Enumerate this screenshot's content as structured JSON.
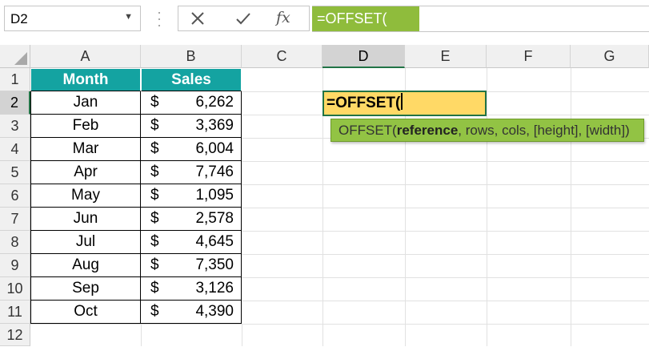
{
  "name_box": {
    "value": "D2"
  },
  "formula_bar": {
    "fx_label": "fx",
    "value": "=OFFSET("
  },
  "columns": [
    "A",
    "B",
    "C",
    "D",
    "E",
    "F",
    "G"
  ],
  "rows": [
    "1",
    "2",
    "3",
    "4",
    "5",
    "6",
    "7",
    "8",
    "9",
    "10",
    "11",
    "12"
  ],
  "table": {
    "headers": [
      "Month",
      "Sales"
    ],
    "currency": "$",
    "rows": [
      {
        "month": "Jan",
        "sales": "6,262"
      },
      {
        "month": "Feb",
        "sales": "3,369"
      },
      {
        "month": "Mar",
        "sales": "6,004"
      },
      {
        "month": "Apr",
        "sales": "7,746"
      },
      {
        "month": "May",
        "sales": "1,095"
      },
      {
        "month": "Jun",
        "sales": "2,578"
      },
      {
        "month": "Jul",
        "sales": "4,645"
      },
      {
        "month": "Aug",
        "sales": "7,350"
      },
      {
        "month": "Sep",
        "sales": "3,126"
      },
      {
        "month": "Oct",
        "sales": "4,390"
      }
    ]
  },
  "active_cell": {
    "value": "=OFFSET("
  },
  "tooltip": {
    "func": "OFFSET(",
    "arg_current": "reference",
    "rest": ", rows, cols, [height], [width])"
  },
  "colors": {
    "header_fill": "#14a3a1",
    "active_cell_fill": "#ffd966",
    "tooltip_fill": "#92c344",
    "selection_border": "#217346"
  }
}
